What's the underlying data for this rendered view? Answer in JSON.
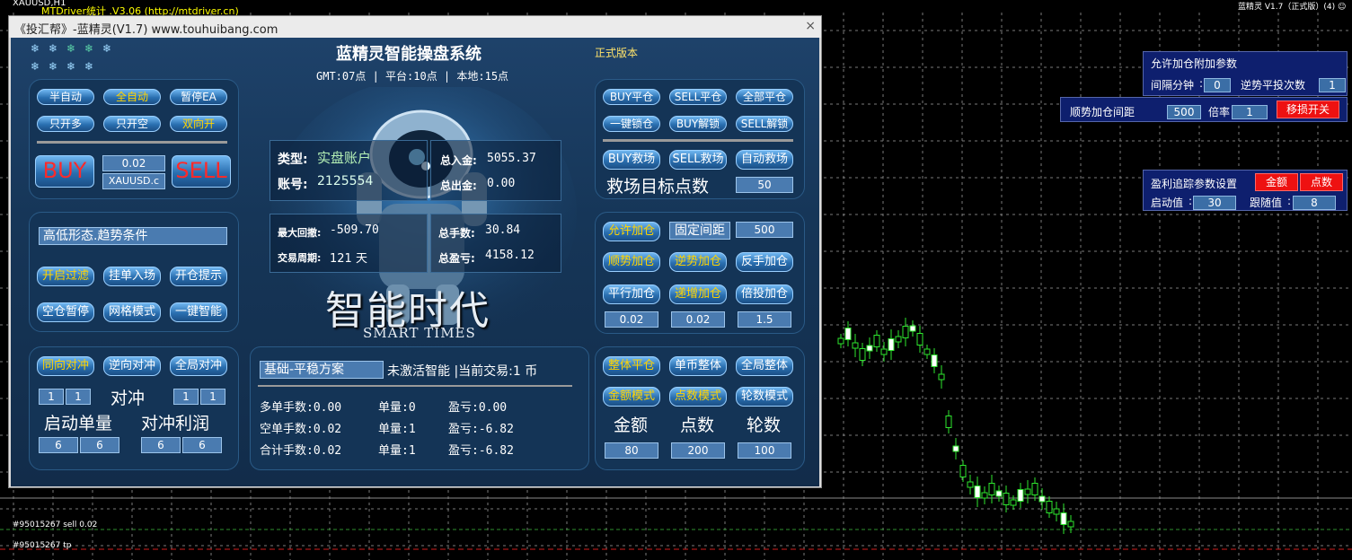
{
  "chart_window": {
    "symbol_title": "XAUUSD,H1",
    "mtdriver_label": "MTDriver统计 .V3.06 (http://mtdriver.cn)",
    "ea_status": "蓝精灵 V1.7（正式版）(4) ☺",
    "order_line_1": "#95015267 sell 0.02",
    "order_line_2": "#95015267 tp"
  },
  "window": {
    "title": "《投汇帮》-蓝精灵(V1.7) www.touhuibang.com",
    "close": "×"
  },
  "header": {
    "system_name": "蓝精灵智能操盘系统",
    "version": "正式版本",
    "times": "GMT:07点 | 平台:10点 | 本地:15点"
  },
  "stars": [
    "❄",
    "❄",
    "❄",
    "❄",
    "❄",
    "❄",
    "❄",
    "❄",
    "❄"
  ],
  "mode_panel": {
    "btn1": "半自动",
    "btn2": "全自动",
    "btn3": "暂停EA",
    "btn4": "只开多",
    "btn5": "只开空",
    "btn6": "双向开",
    "buy": "BUY",
    "sell": "SELL",
    "lot": "0.02",
    "symbol": "XAUUSD.c"
  },
  "filter_panel": {
    "condition": "高低形态.趋势条件",
    "btn1": "开启过滤",
    "btn2": "挂单入场",
    "btn3": "开仓提示",
    "btn4": "空仓暂停",
    "btn5": "网格模式",
    "btn6": "一键智能"
  },
  "hedge_panel": {
    "btn1": "同向对冲",
    "btn2": "逆向对冲",
    "btn3": "全局对冲",
    "hedge_label": "对冲",
    "f1": "1",
    "f2": "1",
    "f3": "1",
    "f4": "1",
    "start_lot_label": "启动单量",
    "hedge_profit_label": "对冲利润",
    "f5": "6",
    "f6": "6",
    "f7": "6",
    "f8": "6"
  },
  "account": {
    "type_label": "类型:",
    "type_value": "实盘账户",
    "number_label": "账号:",
    "number_value": "2125554",
    "deposit_label": "总入金:",
    "deposit_value": "5055.37",
    "withdraw_label": "总出金:",
    "withdraw_value": "0.00",
    "drawdown_label": "最大回撤:",
    "drawdown_value": "-509.70",
    "period_label": "交易周期:",
    "period_value": "121 天",
    "lots_label": "总手数:",
    "lots_value": "30.84",
    "profit_label": "总盈亏:",
    "profit_value": "4158.12"
  },
  "slogan": {
    "cn": "智能时代",
    "en": "SMART TIMES"
  },
  "plan_panel": {
    "plan": "基础-平稳方案",
    "status": "未激活智能 |当前交易:1 币",
    "row1_a": "多单手数:0.00",
    "row1_b": "单量:0",
    "row1_c": "盈亏:0.00",
    "row2_a": "空单手数:0.02",
    "row2_b": "单量:1",
    "row2_c": "盈亏:-6.82",
    "row3_a": "合计手数:0.02",
    "row3_b": "单量:1",
    "row3_c": "盈亏:-6.82"
  },
  "close_panel": {
    "btn1": "BUY平仓",
    "btn2": "SELL平仓",
    "btn3": "全部平仓",
    "btn4": "一键锁仓",
    "btn5": "BUY解锁",
    "btn6": "SELL解锁",
    "btn7": "BUY救场",
    "btn8": "SELL救场",
    "btn9": "自动救场",
    "rescue_label": "救场目标点数",
    "rescue_value": "50"
  },
  "add_panel": {
    "btn1": "允许加仓",
    "interval_mode": "固定间距",
    "interval_value": "500",
    "btn2": "顺势加仓",
    "btn3": "逆势加仓",
    "btn4": "反手加仓",
    "btn5": "平行加仓",
    "btn6": "递增加仓",
    "btn7": "倍投加仓",
    "v1": "0.02",
    "v2": "0.02",
    "v3": "1.5"
  },
  "tp_panel": {
    "btn1": "整体平仓",
    "btn2": "单币整体",
    "btn3": "全局整体",
    "btn4": "金额模式",
    "btn5": "点数模式",
    "btn6": "轮数模式",
    "l1": "金额",
    "l2": "点数",
    "l3": "轮数",
    "v1": "80",
    "v2": "200",
    "v3": "100"
  },
  "add_params": {
    "title": "允许加仓附加参数",
    "interval_min_label": "间隔分钟",
    "interval_min": "0",
    "counter_label": "逆势平投次数",
    "counter_value": "1",
    "trend_dist_label": "顺势加仓间距",
    "trend_dist": "500",
    "mult_label": "倍率",
    "mult": "1",
    "stop_switch": "移损开关"
  },
  "trail_params": {
    "title": "盈利追踪参数设置",
    "btn_amount": "金额",
    "btn_points": "点数",
    "start_label": "启动值",
    "start_value": "30",
    "follow_label": "跟随值",
    "follow_value": "8"
  }
}
